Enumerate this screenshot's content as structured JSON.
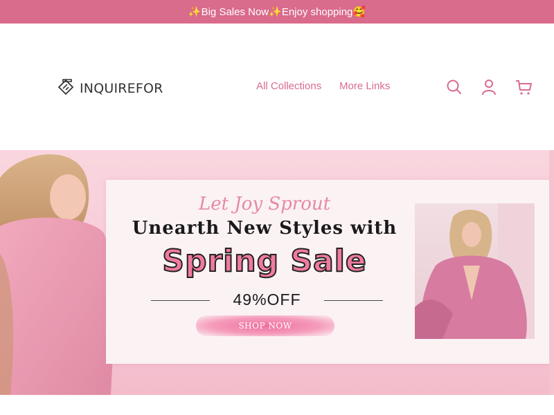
{
  "announcement": {
    "text": "✨Big Sales Now✨Enjoy shopping🥰"
  },
  "header": {
    "logo_text": "INQUIREFOR",
    "nav": [
      {
        "label": "All Collections"
      },
      {
        "label": "More Links"
      }
    ],
    "icons": [
      "search-icon",
      "account-icon",
      "cart-icon"
    ]
  },
  "hero": {
    "tagline": "Let Joy Sprout",
    "headline": "Unearth New Styles with",
    "sale": "Spring Sale",
    "discount": "49%OFF",
    "button_label": "SHOP NOW"
  },
  "colors": {
    "accent": "#d96b8c",
    "announce_bg": "#d96b8c",
    "hero_pink": "#f7c9d6",
    "sale_pink": "#f07a9f"
  }
}
